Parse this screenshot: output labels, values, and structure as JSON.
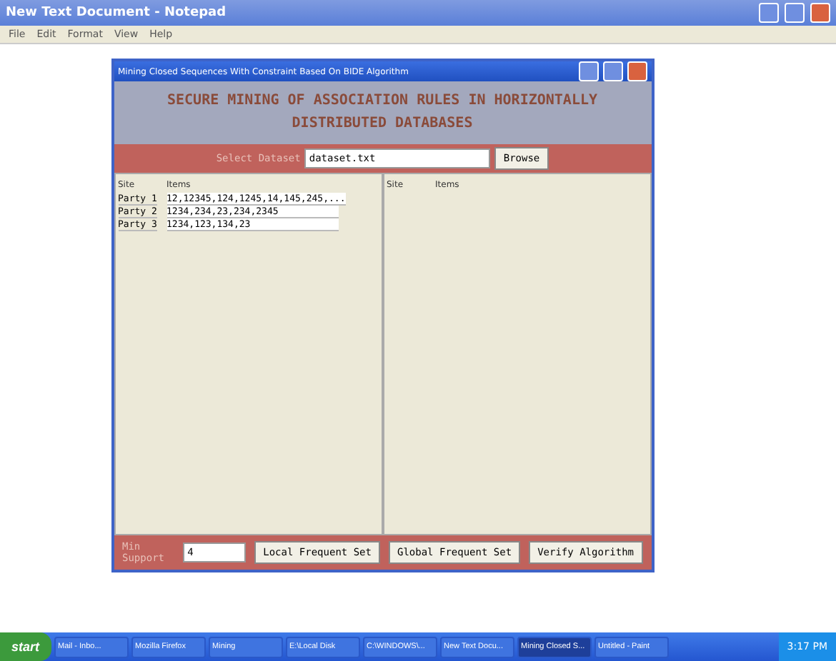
{
  "notepad": {
    "title": "New Text Document - Notepad",
    "menu": [
      "File",
      "Edit",
      "Format",
      "View",
      "Help"
    ]
  },
  "app": {
    "title": "Mining Closed Sequences With Constraint Based On BIDE Algorithm",
    "heading": "SECURE MINING OF ASSOCIATION RULES IN HORIZONTALLY DISTRIBUTED DATABASES",
    "dataset": {
      "label": "Select Dataset",
      "value": "dataset.txt",
      "button": "Browse"
    },
    "left_table": {
      "columns": [
        "Site",
        "Items"
      ],
      "rows": [
        [
          "Party 1",
          "12,12345,124,1245,14,145,245,..."
        ],
        [
          "Party 2",
          "1234,234,23,234,2345"
        ],
        [
          "Party 3",
          "1234,123,134,23"
        ]
      ]
    },
    "right_table": {
      "columns": [
        "Site",
        "Items"
      ]
    },
    "support": {
      "label": "Min Support",
      "value": "4"
    },
    "buttons": [
      "Local Frequent Set",
      "Global Frequent Set",
      "Verify Algorithm"
    ]
  },
  "taskbar": {
    "start": "start",
    "tasks": [
      {
        "label": "Mail - Inbo...",
        "selected": false
      },
      {
        "label": "Mozilla Firefox",
        "selected": false
      },
      {
        "label": "Mining",
        "selected": false
      },
      {
        "label": "E:\\Local Disk",
        "selected": false
      },
      {
        "label": "C:\\WINDOWS\\...",
        "selected": false
      },
      {
        "label": "New Text Docu...",
        "selected": false
      },
      {
        "label": "Mining Closed S...",
        "selected": true
      },
      {
        "label": "Untitled - Paint",
        "selected": false
      }
    ],
    "clock": "3:17 PM"
  }
}
